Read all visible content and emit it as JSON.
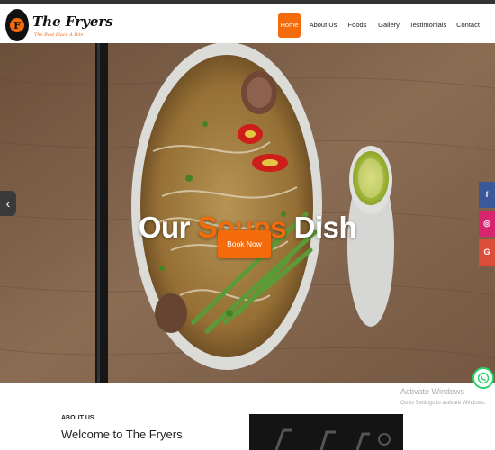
{
  "brand": {
    "name": "The Fryers",
    "tagline": "The Best Place A Bite"
  },
  "nav": {
    "items": [
      {
        "label": "Home",
        "active": true
      },
      {
        "label": "About Us",
        "active": false
      },
      {
        "label": "Foods",
        "active": false
      },
      {
        "label": "Gallery",
        "active": false
      },
      {
        "label": "Testimonials",
        "active": false
      },
      {
        "label": "Contact",
        "active": false
      }
    ]
  },
  "hero": {
    "title_part1": "Our",
    "title_accent": "Soups",
    "title_part2": "Dish",
    "button_label": "Book Now",
    "prev_icon": "‹"
  },
  "social": {
    "facebook": "f",
    "instagram": "◎",
    "google": "G"
  },
  "watermark": {
    "title": "Activate Windows",
    "subtitle": "Go to Settings to activate Windows."
  },
  "about": {
    "label": "ABOUT US",
    "title": "Welcome to The Fryers"
  },
  "colors": {
    "accent": "#f36b0a",
    "facebook": "#3b5998",
    "instagram": "#d6246e",
    "google": "#dd4b39",
    "whatsapp": "#25d366"
  }
}
